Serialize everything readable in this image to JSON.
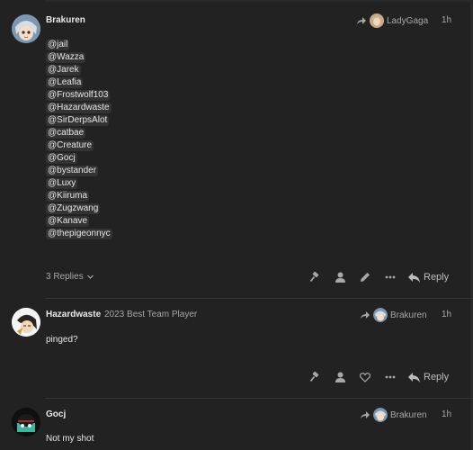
{
  "posts": [
    {
      "username": "Brakuren",
      "flair": "",
      "reply_to": "LadyGaga",
      "time": "1h",
      "mentions": [
        "@jail",
        "@Wazza",
        "@Jarek",
        "@Leafia",
        "@Frostwolf103",
        "@Hazardwaste",
        "@SirDerpsAlot",
        "@catbae",
        "@Creature",
        "@Gocj",
        "@bystander",
        "@Luxy",
        "@Kiiruma",
        "@Zugzwang",
        "@Kanave",
        "@thepigeonnyc"
      ],
      "replies_label": "3 Replies",
      "reply_label": "Reply"
    },
    {
      "username": "Hazardwaste",
      "flair": "2023 Best Team Player",
      "reply_to": "Brakuren",
      "time": "1h",
      "text": "pinged?",
      "reply_label": "Reply"
    },
    {
      "username": "Gocj",
      "flair": "",
      "reply_to": "Brakuren",
      "time": "1h",
      "text": "Not my shot"
    }
  ],
  "colors": {
    "background": "#222222",
    "text": "#dddddd",
    "muted": "#a8a8a8",
    "mention_bg": "#333333",
    "divider": "#363636"
  },
  "icons": [
    "share-arrow-icon",
    "gavel-icon",
    "user-icon",
    "pencil-icon",
    "more-icon",
    "reply-icon",
    "heart-icon",
    "chevron-down-icon"
  ]
}
